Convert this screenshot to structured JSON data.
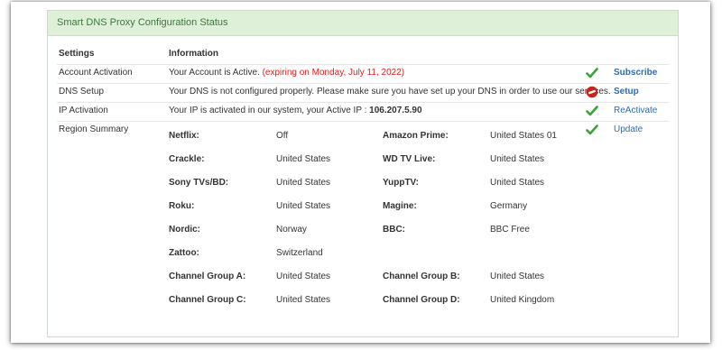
{
  "panel": {
    "title": "Smart DNS Proxy Configuration Status"
  },
  "table": {
    "header": {
      "settings": "Settings",
      "information": "Information"
    },
    "rows": [
      {
        "setting": "Account Activation",
        "info": "Your Account is Active.",
        "info_extra": "(expiring on Monday, July 11, 2022)",
        "status_icon": "check-icon",
        "link": "Subscribe"
      },
      {
        "setting": "DNS Setup",
        "info": "Your DNS is not configured properly. Please make sure you have set up your DNS in order to use our services.",
        "status_icon": "error-icon",
        "link": "Setup"
      },
      {
        "setting": "IP Activation",
        "info": "Your IP is activated in our system, your Active IP :",
        "info_ip": "106.207.5.90",
        "status_icon": "check-icon",
        "link": "ReActivate"
      },
      {
        "setting": "Region Summary",
        "status_icon": "check-icon",
        "link": "Update"
      }
    ]
  },
  "regions": [
    {
      "name": "Netflix:",
      "value": "Off"
    },
    {
      "name": "Amazon Prime:",
      "value": "United States 01"
    },
    {
      "name": "Crackle:",
      "value": "United States"
    },
    {
      "name": "WD TV Live:",
      "value": "United States"
    },
    {
      "name": "Sony TVs/BD:",
      "value": "United States"
    },
    {
      "name": "YuppTV:",
      "value": "United States"
    },
    {
      "name": "Roku:",
      "value": "United States"
    },
    {
      "name": "Magine:",
      "value": "Germany"
    },
    {
      "name": "Nordic:",
      "value": "Norway"
    },
    {
      "name": "BBC:",
      "value": "BBC Free"
    },
    {
      "name": "Zattoo:",
      "value": "Switzerland"
    },
    {
      "name": "Channel Group A:",
      "value": "United States"
    },
    {
      "name": "Channel Group B:",
      "value": "United States"
    },
    {
      "name": "Channel Group C:",
      "value": "United States"
    },
    {
      "name": "Channel Group D:",
      "value": "United Kingdom"
    }
  ],
  "colors": {
    "header_bg": "#dff0d8",
    "header_text": "#3c763d",
    "expiry_red": "#e8191b",
    "link_blue": "#2c6cb8",
    "check_green": "#3aa335",
    "error_red": "#c9231b"
  }
}
